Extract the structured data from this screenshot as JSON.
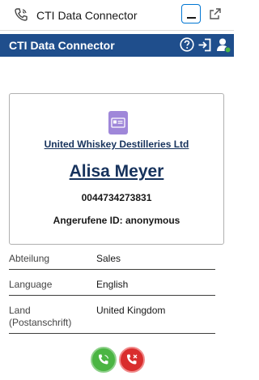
{
  "utility_bar": {
    "title": "CTI Data Connector",
    "icons": [
      "phone-icon",
      "minimize-icon",
      "popout-icon"
    ]
  },
  "panel": {
    "title": "CTI Data Connector",
    "icons": [
      "help-icon",
      "login-icon",
      "agent-status-icon"
    ],
    "colors": {
      "header_bg": "#1f4e8c",
      "link": "#16325c",
      "contact_icon": "#9f87d9"
    }
  },
  "caller": {
    "company": "United Whiskey Destilleries Ltd",
    "name": "Alisa Meyer",
    "phone": "0044734273831",
    "caller_id": "Angerufene ID: anonymous"
  },
  "details": [
    {
      "label": "Abteilung",
      "value": "Sales"
    },
    {
      "label": "Language",
      "value": "English"
    },
    {
      "label": "Land (Postanschrift)",
      "value": "United Kingdom"
    }
  ],
  "actions": {
    "accept_color": "#4bb543",
    "reject_color": "#d92d2d"
  }
}
